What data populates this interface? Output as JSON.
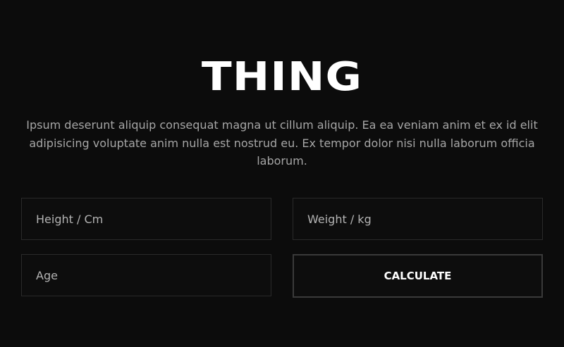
{
  "header": {
    "title": "THING",
    "description": "Ipsum deserunt aliquip consequat magna ut cillum aliquip. Ea ea veniam anim et ex id elit adipisicing voluptate anim nulla est nostrud eu. Ex tempor dolor nisi nulla laborum officia laborum."
  },
  "form": {
    "height_placeholder": "Height / Cm",
    "weight_placeholder": "Weight / kg",
    "age_placeholder": "Age",
    "calculate_label": "CALCULATE"
  },
  "colors": {
    "background": "#0c0c0c",
    "title": "#ffffff",
    "description": "#a6a6a6",
    "field_border": "#2a2a2a",
    "button_border": "#3a3a3a"
  }
}
